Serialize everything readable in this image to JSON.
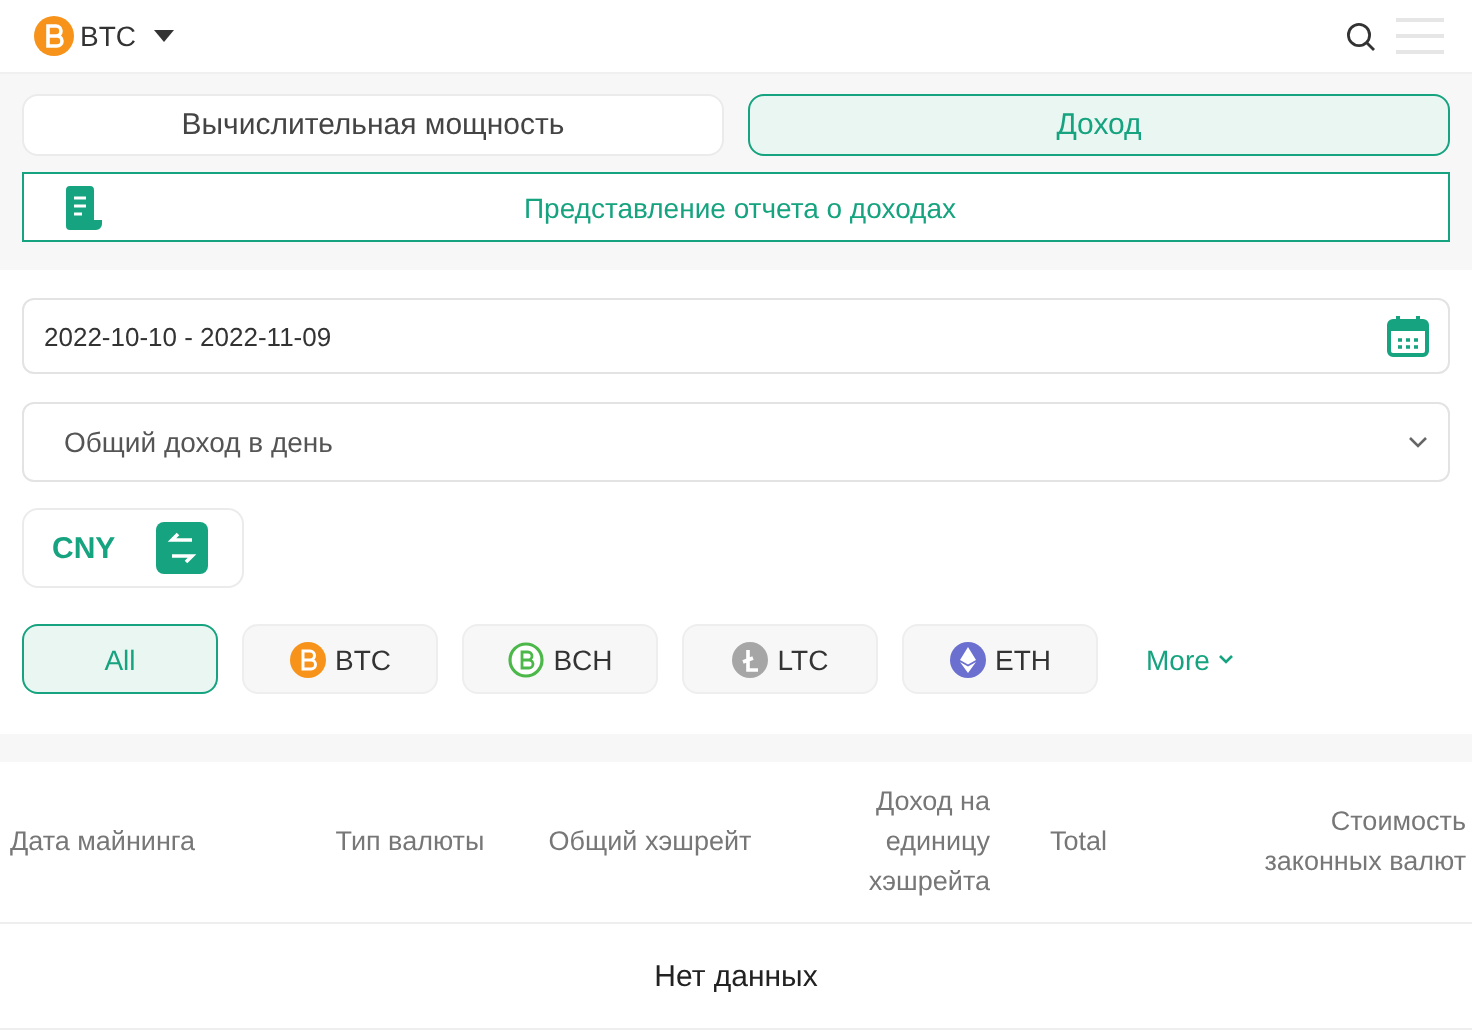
{
  "header": {
    "coin": "BTC"
  },
  "tabs": [
    {
      "label": "Вычислительная мощность",
      "selected": false
    },
    {
      "label": "Доход",
      "selected": true
    }
  ],
  "report_link": "Представление отчета о доходах",
  "date_range": {
    "value": "2022-10-10 - 2022-11-09"
  },
  "income_select": {
    "value": "Общий доход в день"
  },
  "currency": "CNY",
  "coins": [
    {
      "label": "All",
      "selected": true
    },
    {
      "label": "BTC",
      "selected": false,
      "kind": "btc",
      "color": "#f7931a"
    },
    {
      "label": "BCH",
      "selected": false,
      "kind": "bch",
      "color": "#4cb84a"
    },
    {
      "label": "LTC",
      "selected": false,
      "kind": "ltc",
      "color": "#a6a6a6"
    },
    {
      "label": "ETH",
      "selected": false,
      "kind": "eth",
      "color": "#6a6fd0"
    }
  ],
  "more": "More",
  "table": {
    "columns": [
      "Дата майнинга",
      "Тип валюты",
      "Общий хэшрейт",
      "Доход на единицу хэшрейта",
      "Total",
      "Стоимость законных валют"
    ],
    "empty": "Нет данных"
  }
}
